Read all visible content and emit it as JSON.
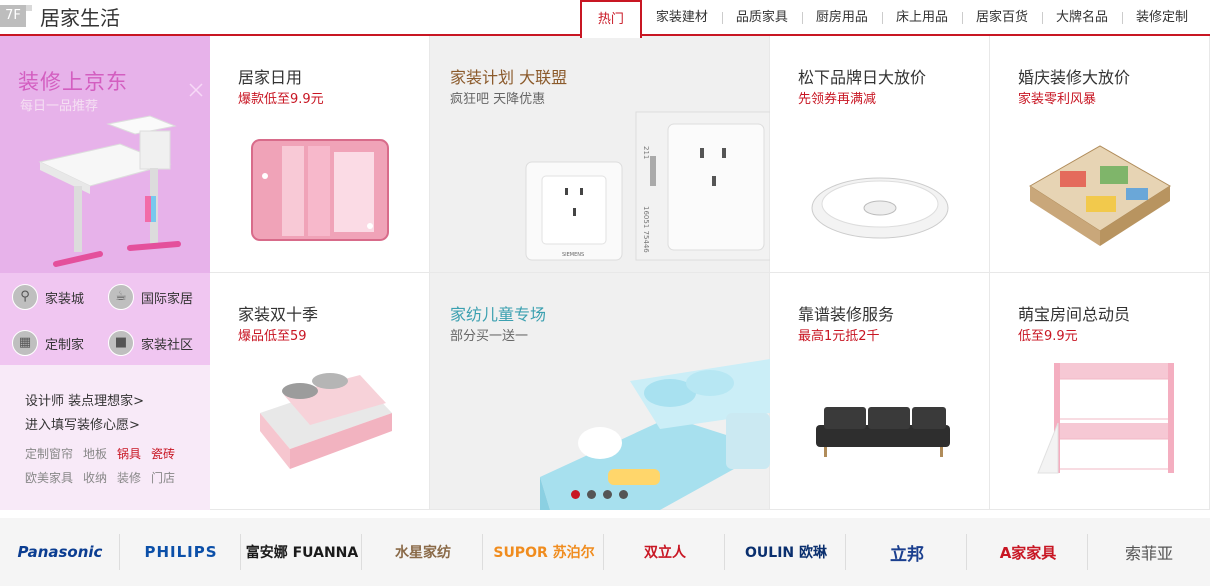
{
  "header": {
    "floor_badge": "7F",
    "title": "居家生活",
    "tabs": [
      "热门",
      "家装建材",
      "品质家具",
      "厨房用品",
      "床上用品",
      "居家百货",
      "大牌名品",
      "装修定制"
    ]
  },
  "left": {
    "promo_title": "装修上京东",
    "promo_sub": "每日一品推荐",
    "categories": [
      "家装城",
      "国际家居",
      "定制家",
      "家装社区"
    ],
    "links": [
      "设计师 装点理想家>",
      "进入填写装修心愿>"
    ],
    "keywords_row1": [
      "定制窗帘",
      "地板",
      "锅具",
      "瓷砖"
    ],
    "keywords_row2": [
      "欧美家具",
      "收纳",
      "装修",
      "门店"
    ]
  },
  "grid": {
    "c1": {
      "title": "居家日用",
      "sub": "爆款低至9.9元"
    },
    "c2": {
      "title": "家装计划 大联盟",
      "sub": "疯狂吧 天降优惠"
    },
    "c3": {
      "title": "松下品牌日大放价",
      "sub": "先领券再满减"
    },
    "c4": {
      "title": "婚庆装修大放价",
      "sub": "家装零利风暴"
    },
    "c5": {
      "title": "家装双十季",
      "sub": "爆品低至59"
    },
    "c6": {
      "title": "家纺儿童专场",
      "sub": "部分买一送一"
    },
    "c7": {
      "title": "靠谱装修服务",
      "sub": "最高1元抵2千"
    },
    "c8": {
      "title": "萌宝房间总动员",
      "sub": "低至9.9元"
    }
  },
  "socket_codes": [
    "211",
    "16051 75446",
    "SIEMENS"
  ],
  "brands": [
    "Panasonic",
    "PHILIPS",
    "富安娜 FUANNA",
    "水星家纺",
    "SUPOR 苏泊尔",
    "双立人",
    "OULIN 欧琳",
    "立邦",
    "A家家具",
    "索菲亚"
  ],
  "colors": {
    "accent": "#c81623",
    "promo_bg": "#e7b2ea"
  }
}
